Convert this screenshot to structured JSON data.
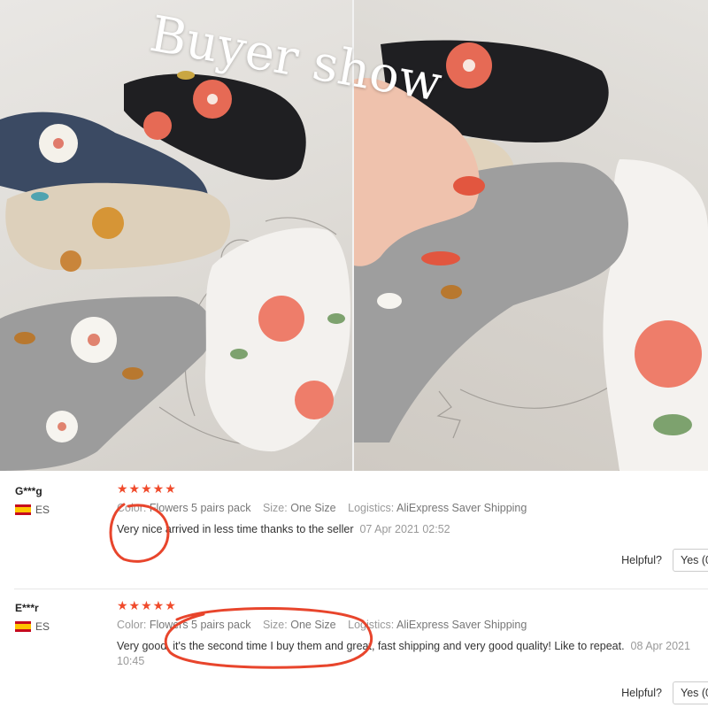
{
  "photos": {
    "watermark": "Buyer show"
  },
  "reviews": [
    {
      "user": "G***g",
      "country": "ES",
      "stars": "★★★★★",
      "color_label": "Color:",
      "color_value": "Flowers 5 pairs pack",
      "size_label": "Size:",
      "size_value": "One Size",
      "logistics_label": "Logistics:",
      "logistics_value": "AliExpress Saver Shipping",
      "comment": "Very nice arrived in less time thanks to the seller",
      "date": "07 Apr 2021 02:52",
      "helpful_label": "Helpful?",
      "yes_label": "Yes (0"
    },
    {
      "user": "E***r",
      "country": "ES",
      "stars": "★★★★★",
      "color_label": "Color:",
      "color_value": "Flowers 5 pairs pack",
      "size_label": "Size:",
      "size_value": "One Size",
      "logistics_label": "Logistics:",
      "logistics_value": "AliExpress Saver Shipping",
      "comment": "Very good, it's the second time I buy them and great, fast shipping and very good quality! Like to repeat.",
      "date": "08 Apr 2021 10:45",
      "helpful_label": "Helpful?",
      "yes_label": "Yes (0"
    }
  ],
  "colors": {
    "star": "#f04a2b",
    "annotation": "#e8452c",
    "flag_red": "#c60b1e",
    "flag_yellow": "#ffc400"
  }
}
